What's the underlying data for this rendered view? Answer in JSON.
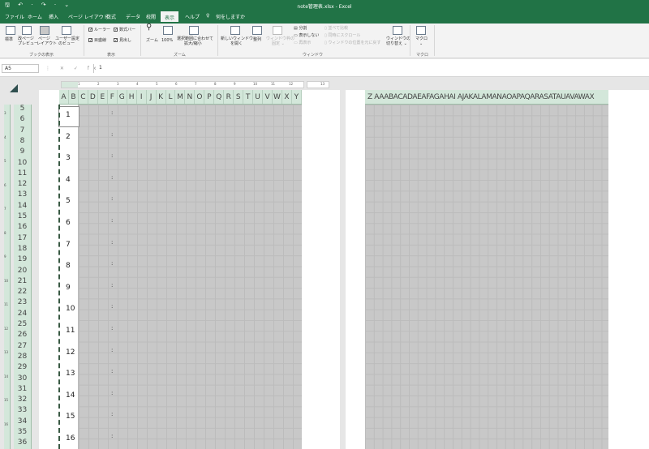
{
  "window": {
    "title": "note管理表.xlsx  -  Excel",
    "quick_access": "🖫 ↶ · ↷ · ⌄"
  },
  "tabs": [
    {
      "label": "ファイル",
      "active": false
    },
    {
      "label": "ホーム",
      "active": false
    },
    {
      "label": "挿入",
      "active": false
    },
    {
      "label": "ページ レイアウト",
      "active": false
    },
    {
      "label": "数式",
      "active": false
    },
    {
      "label": "データ",
      "active": false
    },
    {
      "label": "校閲",
      "active": false
    },
    {
      "label": "表示",
      "active": true
    },
    {
      "label": "ヘルプ",
      "active": false
    },
    {
      "label": "何をしますか",
      "active": false
    }
  ],
  "ribbon": {
    "book_views": {
      "normal": "標準",
      "page_break_1": "改ページ",
      "page_break_2": "プレビュー",
      "page_layout_1": "ページ",
      "page_layout_2": "レイアウト",
      "custom_1": "ユーザー設定",
      "custom_2": "のビュー",
      "group": "ブックの表示"
    },
    "show": {
      "ruler": "ルーラー",
      "formula_bar": "数式バー",
      "gridlines": "目盛線",
      "headings": "見出し",
      "group": "表示"
    },
    "zoom": {
      "zoom": "ズーム",
      "hundred": "100%",
      "fit_1": "選択範囲に合わせて",
      "fit_2": "拡大/縮小",
      "group": "ズーム"
    },
    "window": {
      "new_1": "新しいウィンドウ",
      "new_2": "を開く",
      "arrange": "整列",
      "freeze_1": "ウィンドウ枠の",
      "freeze_2": "固定 ⌄",
      "split": "分割",
      "hide": "表示しない",
      "unhide": "再表示",
      "side_by_side": "並べて比較",
      "sync_scroll": "同時にスクロール",
      "reset_pos": "ウィンドウの位置を元に戻す",
      "switch_1": "ウィンドウの",
      "switch_2": "切り替え ⌄",
      "group": "ウィンドウ"
    },
    "macro": {
      "label": "マクロ",
      "sub": "⌄",
      "group": "マクロ"
    }
  },
  "formula_bar": {
    "name_box": "A5",
    "icons": "⋮ ✕ ✓ fx",
    "value": "1"
  },
  "ruler": {
    "marks": [
      "1",
      "2",
      "3",
      "4",
      "5",
      "6",
      "7",
      "8",
      "9",
      "10",
      "11",
      "12"
    ],
    "page2_mark": "13"
  },
  "columns_page1": [
    "A",
    "B",
    "C",
    "D",
    "E",
    "F",
    "G",
    "H",
    "I",
    "J",
    "K",
    "L",
    "M",
    "N",
    "O",
    "P",
    "Q",
    "R",
    "S",
    "T",
    "U",
    "V",
    "W",
    "X",
    "Y"
  ],
  "columns_page2": "Z AAABACADAEAFAGAHAI AJAKALAMANAOAPAQARASATAUAVAWAX",
  "rows": [
    "5",
    "6",
    "7",
    "8",
    "9",
    "10",
    "11",
    "12",
    "13",
    "14",
    "15",
    "16",
    "17",
    "18",
    "19",
    "20",
    "21",
    "22",
    "23",
    "24",
    "25",
    "26",
    "27",
    "28",
    "29",
    "30",
    "31",
    "32",
    "33",
    "34",
    "35",
    "36"
  ],
  "vruler_marks": [
    "3",
    "4",
    "5",
    "6",
    "7",
    "8",
    "9",
    "10",
    "11",
    "12",
    "13",
    "14",
    "15",
    "16"
  ],
  "cells": {
    "numbers": [
      "1",
      "2",
      "3",
      "4",
      "5",
      "6",
      "7",
      "8",
      "9",
      "10",
      "11",
      "12",
      "13",
      "14",
      "15",
      "16"
    ],
    "colon": ":"
  }
}
